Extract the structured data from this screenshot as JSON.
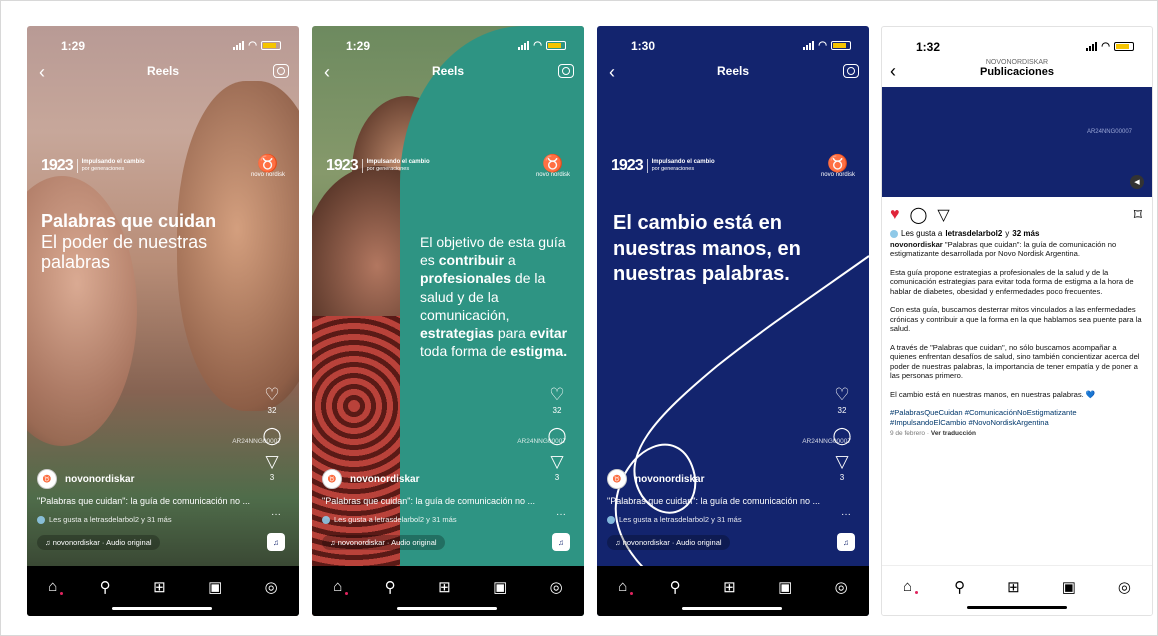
{
  "phones": [
    {
      "time": "1:29",
      "title": "Reels",
      "headline_bold": "Palabras que cuidan",
      "headline_light": "El poder de nuestras palabras",
      "likes_count": "32",
      "shares_count": "3",
      "code": "AR24NNG00007",
      "username": "novonordiskar",
      "caption": "\"Palabras que cuidan\": la guía de comunicación no ...",
      "liked_by": "Les gusta a letrasdelarbol2 y 31 más",
      "audio": "novonordiskar · Audio original"
    },
    {
      "time": "1:29",
      "title": "Reels",
      "text_parts": [
        "El objetivo de esta guía es ",
        "contribuir",
        " a ",
        "profesionales",
        " de la salud y de la comunicación, ",
        "estrategias",
        " para ",
        "evitar",
        " toda forma de ",
        "estigma."
      ],
      "likes_count": "32",
      "shares_count": "3",
      "code": "AR24NNG00007",
      "username": "novonordiskar",
      "caption": "\"Palabras que cuidan\": la guía de comunicación no ...",
      "liked_by": "Les gusta a letrasdelarbol2 y 31 más",
      "audio": "novonordiskar · Audio original"
    },
    {
      "time": "1:30",
      "title": "Reels",
      "headline": "El cambio está en nuestras manos, en nuestras palabras.",
      "likes_count": "32",
      "shares_count": "3",
      "code": "AR24NNG00007",
      "username": "novonordiskar",
      "caption": "\"Palabras que cuidan\": la guía de comunicación no ...",
      "liked_by": "Les gusta a letrasdelarbol2 y 31 más",
      "audio": "novonordiskar · Audio original"
    }
  ],
  "brand": {
    "logo": "1923",
    "tag_bold": "Impulsando el cambio",
    "tag_sub": "por generaciones",
    "company": "novo nordisk"
  },
  "publications": {
    "time": "1:32",
    "account": "NOVONORDISKAR",
    "title": "Publicaciones",
    "code": "AR24NNG00007",
    "liked_prefix": "Les gusta a",
    "liked_user": "letrasdelarbol2",
    "liked_conj": "y",
    "liked_more": "32 más",
    "username": "novonordiskar",
    "caption_intro": "\"Palabras que cuidan\": la guía de comunicación no estigmatizante desarrollada por Novo Nordisk Argentina.",
    "p1": "Esta guía propone estrategias a profesionales de la salud y de la comunicación estrategias para evitar toda forma de estigma a la hora de hablar de diabetes, obesidad y enfermedades poco frecuentes.",
    "p2": "Con esta guía, buscamos desterrar mitos vinculados a las enfermedades crónicas y contribuir a que la forma en la que hablamos sea puente para la salud.",
    "p3": "A través de \"Palabras que cuidan\", no sólo buscamos acompañar a quienes enfrentan desafíos de salud, sino también concientizar acerca del poder de nuestras palabras, la importancia de tener empatía y de poner a las personas primero.",
    "p4": "El cambio está en nuestras manos, en nuestras palabras.",
    "p4_emoji": "💙",
    "hashtags": "#PalabrasQueCuidan #ComunicaciónNoEstigmatizante #ImpulsandoElCambio #NovoNordiskArgentina",
    "date": "9 de febrero",
    "translate": "Ver traducción"
  },
  "icons": {
    "back": "‹",
    "heart": "♡",
    "heart_filled": "♥",
    "comment": "◯",
    "share": "▽",
    "save": "⌑",
    "more": "···",
    "note": "♫",
    "home": "⌂",
    "search": "⚲",
    "add": "⊞",
    "reels": "▣",
    "profile": "◎",
    "wifi": "◠",
    "bull": "♉",
    "mute": "◀"
  }
}
